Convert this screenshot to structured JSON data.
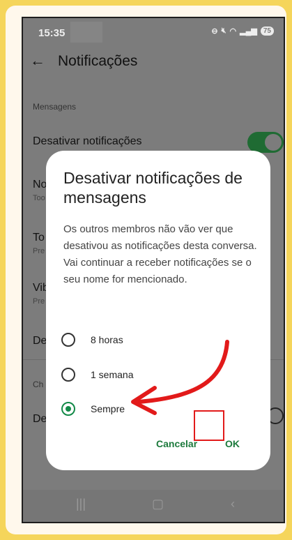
{
  "status": {
    "time": "15:35",
    "battery": "75"
  },
  "header": {
    "title": "Notificações"
  },
  "settings": {
    "section1": "Mensagens",
    "mute_label": "Desativar notificações",
    "row2": {
      "label": "No",
      "sub": "Too"
    },
    "row3": {
      "label": "To",
      "sub": "Pre"
    },
    "row4": {
      "label": "Vib",
      "sub": "Pre"
    },
    "row5": {
      "label": "De"
    },
    "section2": "Ch",
    "row6": {
      "label": "De"
    }
  },
  "dialog": {
    "title": "Desativar notificações de mensagens",
    "body": "Os outros membros não vão ver que desativou as notificações desta conversa. Vai continuar a receber notificações se o seu nome for mencionado.",
    "options": [
      "8 horas",
      "1 semana",
      "Sempre"
    ],
    "selected": "Sempre",
    "cancel": "Cancelar",
    "ok": "OK"
  },
  "colors": {
    "accent": "#138a48",
    "highlight": "#e21a1a",
    "background": "#f5d55b"
  }
}
